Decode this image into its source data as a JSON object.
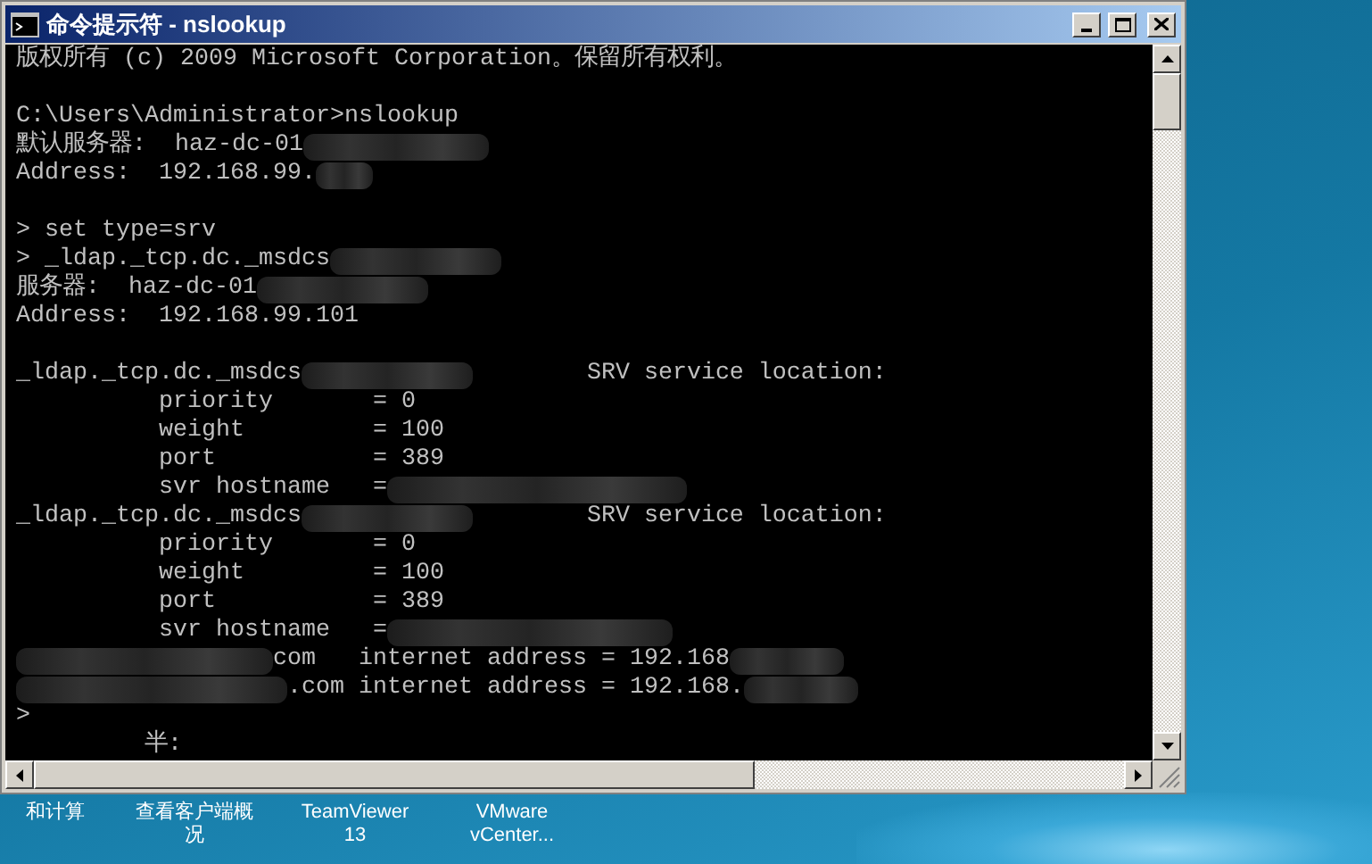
{
  "window": {
    "title": "命令提示符 - nslookup"
  },
  "console": {
    "lines": [
      {
        "kind": "text",
        "segments": [
          {
            "kind": "text",
            "text": "版权所有 (c) 2009 Microsoft Corporation。保留所有权利。"
          }
        ]
      },
      {
        "kind": "blank"
      },
      {
        "kind": "text",
        "segments": [
          {
            "kind": "text",
            "text": "C:\\Users\\Administrator>nslookup"
          }
        ]
      },
      {
        "kind": "text",
        "segments": [
          {
            "kind": "text",
            "text": "默认服务器:  haz-dc-01"
          },
          {
            "kind": "redacted"
          }
        ]
      },
      {
        "kind": "text",
        "segments": [
          {
            "kind": "text",
            "text": "Address:  192.168.99."
          },
          {
            "kind": "redacted"
          }
        ]
      },
      {
        "kind": "blank"
      },
      {
        "kind": "text",
        "segments": [
          {
            "kind": "text",
            "text": "> set type=srv"
          }
        ]
      },
      {
        "kind": "text",
        "segments": [
          {
            "kind": "text",
            "text": "> _ldap._tcp.dc._msdcs"
          },
          {
            "kind": "redacted"
          }
        ]
      },
      {
        "kind": "text",
        "segments": [
          {
            "kind": "text",
            "text": "服务器:  haz-dc-01"
          },
          {
            "kind": "redacted"
          }
        ]
      },
      {
        "kind": "text",
        "segments": [
          {
            "kind": "text",
            "text": "Address:  192.168.99.101"
          }
        ]
      },
      {
        "kind": "blank"
      },
      {
        "kind": "text",
        "segments": [
          {
            "kind": "text",
            "text": "_ldap._tcp.dc._msdcs"
          },
          {
            "kind": "redacted"
          },
          {
            "kind": "text",
            "text": "        SRV service location:"
          }
        ]
      },
      {
        "kind": "text",
        "segments": [
          {
            "kind": "text",
            "text": "          priority       = 0"
          }
        ]
      },
      {
        "kind": "text",
        "segments": [
          {
            "kind": "text",
            "text": "          weight         = 100"
          }
        ]
      },
      {
        "kind": "text",
        "segments": [
          {
            "kind": "text",
            "text": "          port           = 389"
          }
        ]
      },
      {
        "kind": "text",
        "segments": [
          {
            "kind": "text",
            "text": "          svr hostname   ="
          },
          {
            "kind": "redacted"
          }
        ]
      },
      {
        "kind": "text",
        "segments": [
          {
            "kind": "text",
            "text": "_ldap._tcp.dc._msdcs"
          },
          {
            "kind": "redacted"
          },
          {
            "kind": "text",
            "text": "        SRV service location:"
          }
        ]
      },
      {
        "kind": "text",
        "segments": [
          {
            "kind": "text",
            "text": "          priority       = 0"
          }
        ]
      },
      {
        "kind": "text",
        "segments": [
          {
            "kind": "text",
            "text": "          weight         = 100"
          }
        ]
      },
      {
        "kind": "text",
        "segments": [
          {
            "kind": "text",
            "text": "          port           = 389"
          }
        ]
      },
      {
        "kind": "text",
        "segments": [
          {
            "kind": "text",
            "text": "          svr hostname   ="
          },
          {
            "kind": "redacted"
          }
        ]
      },
      {
        "kind": "text",
        "segments": [
          {
            "kind": "redacted"
          },
          {
            "kind": "text",
            "text": "com   internet address = 192.168"
          },
          {
            "kind": "redacted"
          }
        ]
      },
      {
        "kind": "text",
        "segments": [
          {
            "kind": "redacted"
          },
          {
            "kind": "text",
            "text": ".com internet address = 192.168."
          },
          {
            "kind": "redacted"
          }
        ]
      },
      {
        "kind": "text",
        "segments": [
          {
            "kind": "text",
            "text": ">"
          }
        ]
      },
      {
        "kind": "text",
        "segments": [
          {
            "kind": "text",
            "text": "         半:"
          }
        ]
      }
    ]
  },
  "desktop_icons": [
    {
      "label_lines": [
        "和计算"
      ]
    },
    {
      "label_lines": [
        "查看客户端概",
        "况"
      ]
    },
    {
      "label_lines": [
        "TeamViewer",
        "13"
      ]
    },
    {
      "label_lines": [
        "VMware",
        "vCenter..."
      ]
    }
  ]
}
